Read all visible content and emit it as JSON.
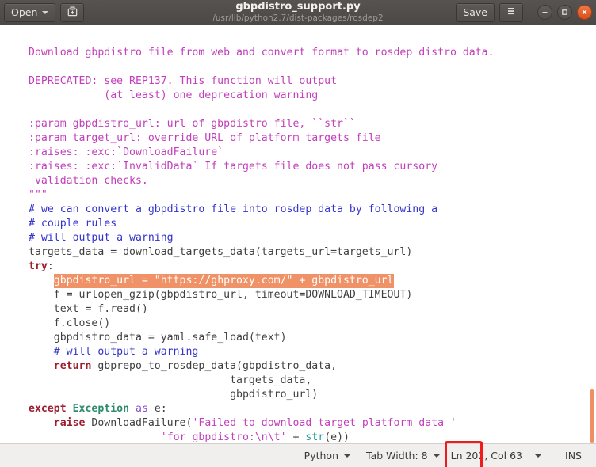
{
  "window": {
    "title": "gbpdistro_support.py",
    "subtitle": "/usr/lib/python2.7/dist-packages/rosdep2",
    "open_label": "Open",
    "save_label": "Save",
    "icons": {
      "open_caret": "chevron-down-icon",
      "new_document": "new-document-icon",
      "menu": "hamburger-menu-icon",
      "minimize": "minimize-icon",
      "maximize": "maximize-icon",
      "close": "close-icon"
    },
    "accent_close": "#e8541d",
    "titlebar_bg": "#4f4c49"
  },
  "editor": {
    "language_theme": {
      "string": "#c23fbb",
      "comment": "#3333cc",
      "keyword": "#9b1d2e",
      "class": "#2e8b6e",
      "builtin": "#2a9d9d",
      "plain": "#3f3f3f",
      "selection_bg": "#f09267",
      "selection_fg": "#ffffff"
    },
    "selected_text": "gbpdistro_url = \"https://ghproxy.com/\" + gbpdistro_url",
    "lines": [
      {
        "indent": 0,
        "spans": [
          {
            "t": "\"\"\"",
            "c": "c-str"
          }
        ]
      },
      {
        "indent": 0,
        "spans": []
      },
      {
        "indent": 0,
        "spans": [
          {
            "t": "Download gbpdistro file from web and convert format to rosdep distro data.",
            "c": "c-str"
          }
        ]
      },
      {
        "indent": 0,
        "spans": []
      },
      {
        "indent": 0,
        "spans": [
          {
            "t": "DEPRECATED: see REP137. This function will output",
            "c": "c-str"
          }
        ]
      },
      {
        "indent": 0,
        "spans": [
          {
            "t": "            (at least) one deprecation warning",
            "c": "c-str"
          }
        ]
      },
      {
        "indent": 0,
        "spans": []
      },
      {
        "indent": 0,
        "spans": [
          {
            "t": ":param gbpdistro_url: url of gbpdistro file, ``str``",
            "c": "c-str"
          }
        ]
      },
      {
        "indent": 0,
        "spans": [
          {
            "t": ":param target_url: override URL of platform targets file",
            "c": "c-str"
          }
        ]
      },
      {
        "indent": 0,
        "spans": [
          {
            "t": ":raises: :exc:`DownloadFailure`",
            "c": "c-str"
          }
        ]
      },
      {
        "indent": 0,
        "spans": [
          {
            "t": ":raises: :exc:`InvalidData` If targets file does not pass cursory",
            "c": "c-str"
          }
        ]
      },
      {
        "indent": 0,
        "spans": [
          {
            "t": " validation checks.",
            "c": "c-str"
          }
        ]
      },
      {
        "indent": 0,
        "spans": [
          {
            "t": "\"\"\"",
            "c": "c-str"
          }
        ]
      },
      {
        "indent": 0,
        "spans": [
          {
            "t": "# we can convert a gbpdistro file into rosdep data by following a",
            "c": "c-com"
          }
        ]
      },
      {
        "indent": 0,
        "spans": [
          {
            "t": "# couple rules",
            "c": "c-com"
          }
        ]
      },
      {
        "indent": 0,
        "spans": [
          {
            "t": "# will output a warning",
            "c": "c-com"
          }
        ]
      },
      {
        "indent": 0,
        "spans": [
          {
            "t": "targets_data = download_targets_data(targets_url=targets_url)",
            "c": "c-txt"
          }
        ]
      },
      {
        "indent": 0,
        "spans": [
          {
            "t": "try",
            "c": "c-kw"
          },
          {
            "t": ":",
            "c": "c-txt"
          }
        ]
      },
      {
        "indent": 4,
        "selected": true,
        "spans": [
          {
            "t": "gbpdistro_url = \"https://ghproxy.com/\" + gbpdistro_url",
            "c": "sel"
          }
        ]
      },
      {
        "indent": 4,
        "spans": [
          {
            "t": "f = urlopen_gzip(gbpdistro_url, timeout=DOWNLOAD_TIMEOUT)",
            "c": "c-txt"
          }
        ]
      },
      {
        "indent": 4,
        "spans": [
          {
            "t": "text = f.read()",
            "c": "c-txt"
          }
        ]
      },
      {
        "indent": 4,
        "spans": [
          {
            "t": "f.close()",
            "c": "c-txt"
          }
        ]
      },
      {
        "indent": 4,
        "spans": [
          {
            "t": "gbpdistro_data = yaml.safe_load(text)",
            "c": "c-txt"
          }
        ]
      },
      {
        "indent": 4,
        "spans": [
          {
            "t": "# will output a warning",
            "c": "c-com"
          }
        ]
      },
      {
        "indent": 4,
        "spans": [
          {
            "t": "return",
            "c": "c-kw"
          },
          {
            "t": " gbprepo_to_rosdep_data(gbpdistro_data,",
            "c": "c-txt"
          }
        ]
      },
      {
        "indent": 4,
        "spans": [
          {
            "t": "                            targets_data,",
            "c": "c-txt"
          }
        ]
      },
      {
        "indent": 4,
        "spans": [
          {
            "t": "                            gbpdistro_url)",
            "c": "c-txt"
          }
        ]
      },
      {
        "indent": 0,
        "spans": [
          {
            "t": "except",
            "c": "c-kw"
          },
          {
            "t": " ",
            "c": "c-txt"
          },
          {
            "t": "Exception",
            "c": "c-cls"
          },
          {
            "t": " ",
            "c": "c-txt"
          },
          {
            "t": "as",
            "c": "c-op"
          },
          {
            "t": " e:",
            "c": "c-txt"
          }
        ]
      },
      {
        "indent": 4,
        "spans": [
          {
            "t": "raise",
            "c": "c-kw"
          },
          {
            "t": " DownloadFailure(",
            "c": "c-txt"
          },
          {
            "t": "'Failed to download target platform data '",
            "c": "c-str"
          }
        ]
      },
      {
        "indent": 4,
        "spans": [
          {
            "t": "                 ",
            "c": "c-txt"
          },
          {
            "t": "'for gbpdistro:\\n\\t'",
            "c": "c-str"
          },
          {
            "t": " + ",
            "c": "c-txt"
          },
          {
            "t": "str",
            "c": "c-bi"
          },
          {
            "t": "(e))",
            "c": "c-txt"
          }
        ]
      }
    ]
  },
  "statusbar": {
    "language": "Python",
    "tab_width": "Tab Width: 8",
    "line_col": "Ln 202, Col 63",
    "insert_mode": "INS",
    "highlight_color": "#f01c1c"
  }
}
